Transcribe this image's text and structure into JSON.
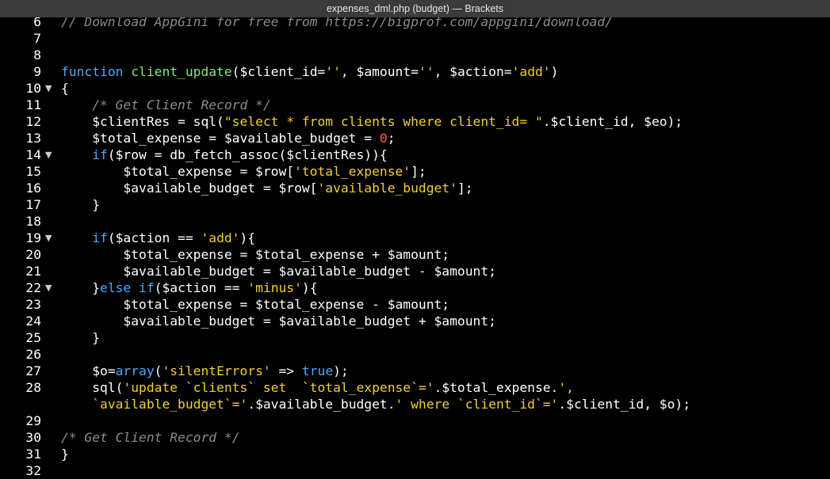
{
  "window": {
    "title": "expenses_dml.php (budget) — Brackets"
  },
  "colors": {
    "background": "#000000",
    "titlebar": "#3b3b3b",
    "keyword": "#4fa8ff",
    "function": "#7ee87e",
    "string": "#f2cf2e",
    "number": "#ff5b4d",
    "comment": "#8c8c8c",
    "plain": "#ffffff"
  },
  "editor": {
    "fold_glyph": "▼",
    "lines": [
      {
        "num": "6",
        "fold": false,
        "tokens": [
          {
            "t": "com",
            "v": "// Download AppGini for free from https://bigprof.com/appgini/download/"
          }
        ]
      },
      {
        "num": "7",
        "fold": false,
        "tokens": []
      },
      {
        "num": "8",
        "fold": false,
        "tokens": []
      },
      {
        "num": "9",
        "fold": false,
        "tokens": [
          {
            "t": "kw",
            "v": "function"
          },
          {
            "t": "op",
            "v": " "
          },
          {
            "t": "fn",
            "v": "client_update"
          },
          {
            "t": "op",
            "v": "($client_id="
          },
          {
            "t": "str",
            "v": "''"
          },
          {
            "t": "op",
            "v": ", $amount="
          },
          {
            "t": "str",
            "v": "''"
          },
          {
            "t": "op",
            "v": ", $action="
          },
          {
            "t": "str",
            "v": "'add'"
          },
          {
            "t": "op",
            "v": ")"
          }
        ]
      },
      {
        "num": "10",
        "fold": true,
        "tokens": [
          {
            "t": "op",
            "v": "{"
          }
        ]
      },
      {
        "num": "11",
        "fold": false,
        "tokens": [
          {
            "t": "op",
            "v": "    "
          },
          {
            "t": "com",
            "v": "/* Get Client Record */"
          }
        ]
      },
      {
        "num": "12",
        "fold": false,
        "tokens": [
          {
            "t": "op",
            "v": "    $clientRes = sql("
          },
          {
            "t": "str",
            "v": "\"select * from clients where client_id= \""
          },
          {
            "t": "op",
            "v": ".$client_id, $eo);"
          }
        ]
      },
      {
        "num": "13",
        "fold": false,
        "tokens": [
          {
            "t": "op",
            "v": "    $total_expense = $available_budget = "
          },
          {
            "t": "num",
            "v": "0"
          },
          {
            "t": "op",
            "v": ";"
          }
        ]
      },
      {
        "num": "14",
        "fold": true,
        "tokens": [
          {
            "t": "op",
            "v": "    "
          },
          {
            "t": "kw",
            "v": "if"
          },
          {
            "t": "op",
            "v": "($row = db_fetch_assoc($clientRes)){"
          }
        ]
      },
      {
        "num": "15",
        "fold": false,
        "tokens": [
          {
            "t": "op",
            "v": "        $total_expense = $row["
          },
          {
            "t": "str",
            "v": "'total_expense'"
          },
          {
            "t": "op",
            "v": "];"
          }
        ]
      },
      {
        "num": "16",
        "fold": false,
        "tokens": [
          {
            "t": "op",
            "v": "        $available_budget = $row["
          },
          {
            "t": "str",
            "v": "'available_budget'"
          },
          {
            "t": "op",
            "v": "];"
          }
        ]
      },
      {
        "num": "17",
        "fold": false,
        "tokens": [
          {
            "t": "op",
            "v": "    }"
          }
        ]
      },
      {
        "num": "18",
        "fold": false,
        "tokens": []
      },
      {
        "num": "19",
        "fold": true,
        "tokens": [
          {
            "t": "op",
            "v": "    "
          },
          {
            "t": "kw",
            "v": "if"
          },
          {
            "t": "op",
            "v": "($action == "
          },
          {
            "t": "str",
            "v": "'add'"
          },
          {
            "t": "op",
            "v": "){"
          }
        ]
      },
      {
        "num": "20",
        "fold": false,
        "tokens": [
          {
            "t": "op",
            "v": "        $total_expense = $total_expense + $amount;"
          }
        ]
      },
      {
        "num": "21",
        "fold": false,
        "tokens": [
          {
            "t": "op",
            "v": "        $available_budget = $available_budget - $amount;"
          }
        ]
      },
      {
        "num": "22",
        "fold": true,
        "tokens": [
          {
            "t": "op",
            "v": "    }"
          },
          {
            "t": "kw",
            "v": "else"
          },
          {
            "t": "op",
            "v": " "
          },
          {
            "t": "kw",
            "v": "if"
          },
          {
            "t": "op",
            "v": "($action == "
          },
          {
            "t": "str",
            "v": "'minus'"
          },
          {
            "t": "op",
            "v": "){"
          }
        ]
      },
      {
        "num": "23",
        "fold": false,
        "tokens": [
          {
            "t": "op",
            "v": "        $total_expense = $total_expense - $amount;"
          }
        ]
      },
      {
        "num": "24",
        "fold": false,
        "tokens": [
          {
            "t": "op",
            "v": "        $available_budget = $available_budget + $amount;"
          }
        ]
      },
      {
        "num": "25",
        "fold": false,
        "tokens": [
          {
            "t": "op",
            "v": "    }"
          }
        ]
      },
      {
        "num": "26",
        "fold": false,
        "tokens": []
      },
      {
        "num": "27",
        "fold": false,
        "tokens": [
          {
            "t": "op",
            "v": "    $o="
          },
          {
            "t": "kw",
            "v": "array"
          },
          {
            "t": "op",
            "v": "("
          },
          {
            "t": "str",
            "v": "'silentErrors'"
          },
          {
            "t": "op",
            "v": " => "
          },
          {
            "t": "kw",
            "v": "true"
          },
          {
            "t": "op",
            "v": ");"
          }
        ]
      },
      {
        "num": "28",
        "fold": false,
        "tokens": [
          {
            "t": "op",
            "v": "    sql("
          },
          {
            "t": "str",
            "v": "'update `clients` set  `total_expense`='"
          },
          {
            "t": "op",
            "v": ".$total_expense."
          },
          {
            "t": "str",
            "v": "',"
          }
        ]
      },
      {
        "num": "",
        "fold": false,
        "tokens": [
          {
            "t": "op",
            "v": "    "
          },
          {
            "t": "str",
            "v": "`available_budget`='"
          },
          {
            "t": "op",
            "v": ".$available_budget."
          },
          {
            "t": "str",
            "v": "' where `client_id`='"
          },
          {
            "t": "op",
            "v": ".$client_id, $o);"
          }
        ]
      },
      {
        "num": "29",
        "fold": false,
        "tokens": []
      },
      {
        "num": "30",
        "fold": false,
        "tokens": [
          {
            "t": "com",
            "v": "/* Get Client Record */"
          }
        ]
      },
      {
        "num": "31",
        "fold": false,
        "tokens": [
          {
            "t": "op",
            "v": "}"
          }
        ]
      },
      {
        "num": "32",
        "fold": false,
        "tokens": []
      }
    ]
  }
}
